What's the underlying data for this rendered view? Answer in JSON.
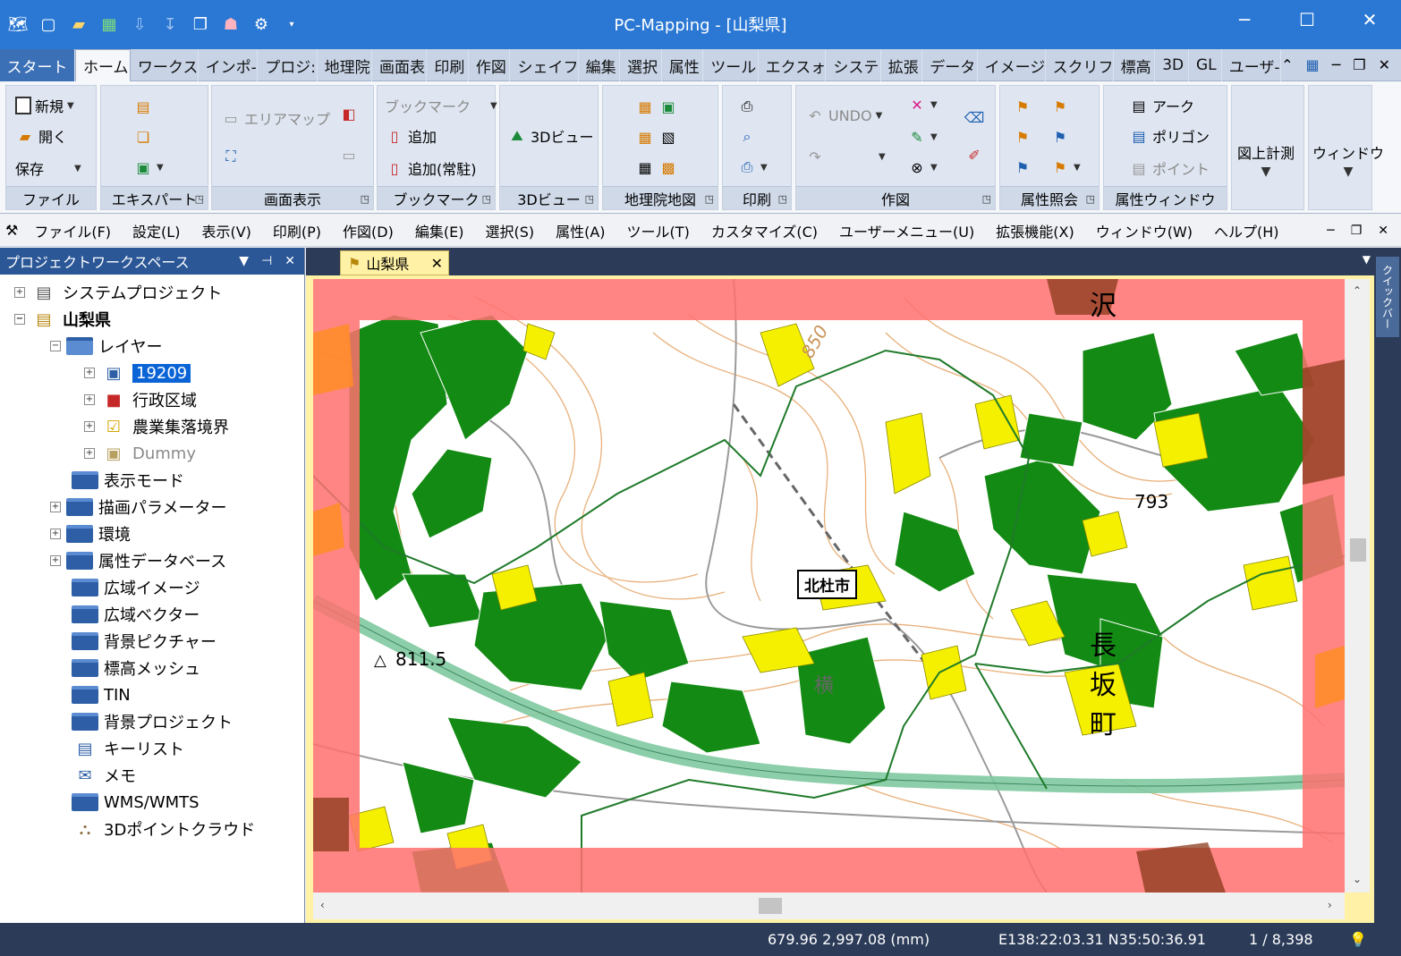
{
  "window": {
    "title": "PC-Mapping - [山梨県]",
    "minimize_icon": "minimize-icon",
    "maximize_icon": "maximize-icon",
    "close_icon": "close-icon"
  },
  "ribbon_tabs": [
    "スタート",
    "ホーム",
    "ワークス",
    "インポ-",
    "プロジ:",
    "地理院",
    "画面表",
    "印刷",
    "作図",
    "シェイフ",
    "編集",
    "選択",
    "属性",
    "ツール",
    "エクスォ",
    "システ",
    "拡張",
    "データ",
    "イメージ",
    "スクリフ",
    "標高",
    "3D",
    "GL",
    "ユーザ-"
  ],
  "ribbon": {
    "file": {
      "new": "新規",
      "open": "開く",
      "save": "保存",
      "label": "ファイル"
    },
    "expert": {
      "label": "エキスパート"
    },
    "screen": {
      "area_map": "エリアマップ",
      "label": "画面表示"
    },
    "bookmark": {
      "header": "ブックマーク",
      "add": "追加",
      "add_fixed": "追加(常駐)",
      "label": "ブックマーク"
    },
    "view3d": {
      "btn": "3Dビュー",
      "label": "3Dビュー"
    },
    "gsi": {
      "label": "地理院地図"
    },
    "print": {
      "label": "印刷"
    },
    "draw": {
      "undo": "UNDO",
      "label": "作図"
    },
    "attr_query": {
      "label": "属性照会"
    },
    "attr_window": {
      "arc": "アーク",
      "polygon": "ポリゴン",
      "point": "ポイント",
      "label": "属性ウィンドウ"
    },
    "measure": "図上計測",
    "window": "ウィンドウ"
  },
  "menu": [
    "ファイル(F)",
    "設定(L)",
    "表示(V)",
    "印刷(P)",
    "作図(D)",
    "編集(E)",
    "選択(S)",
    "属性(A)",
    "ツール(T)",
    "カスタマイズ(C)",
    "ユーザーメニュー(U)",
    "拡張機能(X)",
    "ウィンドウ(W)",
    "ヘルプ(H)"
  ],
  "panel": {
    "title": "プロジェクトワークスペース",
    "tree": {
      "system_project": "システムプロジェクト",
      "project": "山梨県",
      "layers": "レイヤー",
      "layer_19209": "19209",
      "layer_admin": "行政区域",
      "layer_farm": "農業集落境界",
      "layer_dummy": "Dummy",
      "display_mode": "表示モード",
      "draw_params": "描画パラメーター",
      "environment": "環境",
      "attr_db": "属性データベース",
      "wide_image": "広域イメージ",
      "wide_vector": "広域ベクター",
      "bg_picture": "背景ピクチャー",
      "elevation_mesh": "標高メッシュ",
      "tin": "TIN",
      "bg_project": "背景プロジェクト",
      "key_list": "キーリスト",
      "memo": "メモ",
      "wms": "WMS/WMTS",
      "point_cloud": "3Dポイントクラウド"
    }
  },
  "document": {
    "tab": "山梨県"
  },
  "quickbar": {
    "label": "クイックバー"
  },
  "map": {
    "label": "北杜市",
    "elev_850": "850",
    "elev_793": "793",
    "elev_811": "811.5",
    "place_sawa": "沢",
    "place_nagasaka": [
      "長",
      "坂",
      "町"
    ],
    "place_yoko": "横"
  },
  "status": {
    "coords_mm": "679.96 2,997.08 (mm)",
    "lonlat": "E138:22:03.31 N35:50:36.91",
    "page": "1 / 8,398"
  },
  "colors": {
    "accent": "#2b78d4",
    "green_field": "#138a13",
    "yellow_field": "#f5f000",
    "red_overlay": "#ff7070"
  }
}
